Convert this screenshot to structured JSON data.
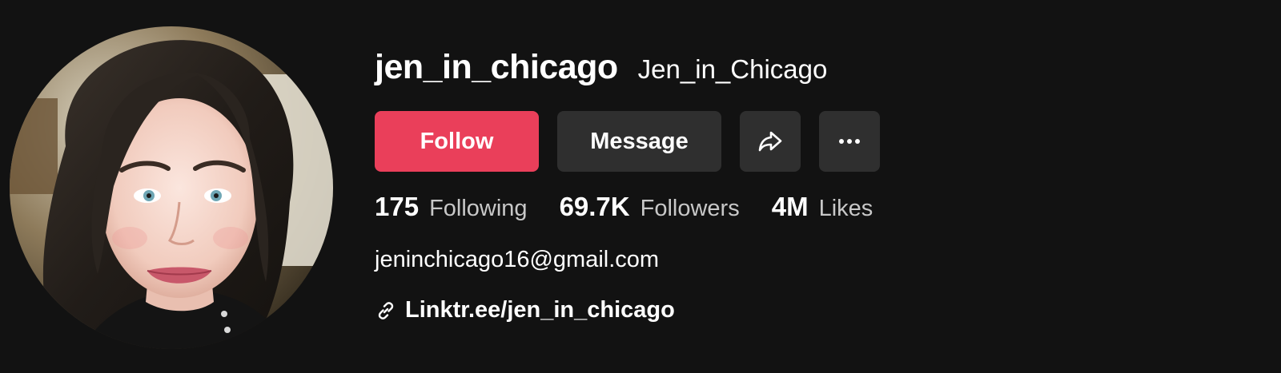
{
  "profile": {
    "username": "jen_in_chicago",
    "nickname": "Jen_in_Chicago",
    "avatar_icon": "profile-photo"
  },
  "actions": {
    "follow_label": "Follow",
    "message_label": "Message",
    "share_icon": "share-icon",
    "more_icon": "more-icon"
  },
  "stats": {
    "following": {
      "count": "175",
      "label": "Following"
    },
    "followers": {
      "count": "69.7K",
      "label": "Followers"
    },
    "likes": {
      "count": "4M",
      "label": "Likes"
    }
  },
  "bio": {
    "email": "jeninchicago16@gmail.com",
    "link_icon": "link-icon",
    "link": "Linktr.ee/jen_in_chicago"
  },
  "colors": {
    "background": "#121212",
    "follow_button": "#ea3f5a",
    "secondary_button": "#2f2f2f",
    "muted_text": "#c8c8c8"
  }
}
